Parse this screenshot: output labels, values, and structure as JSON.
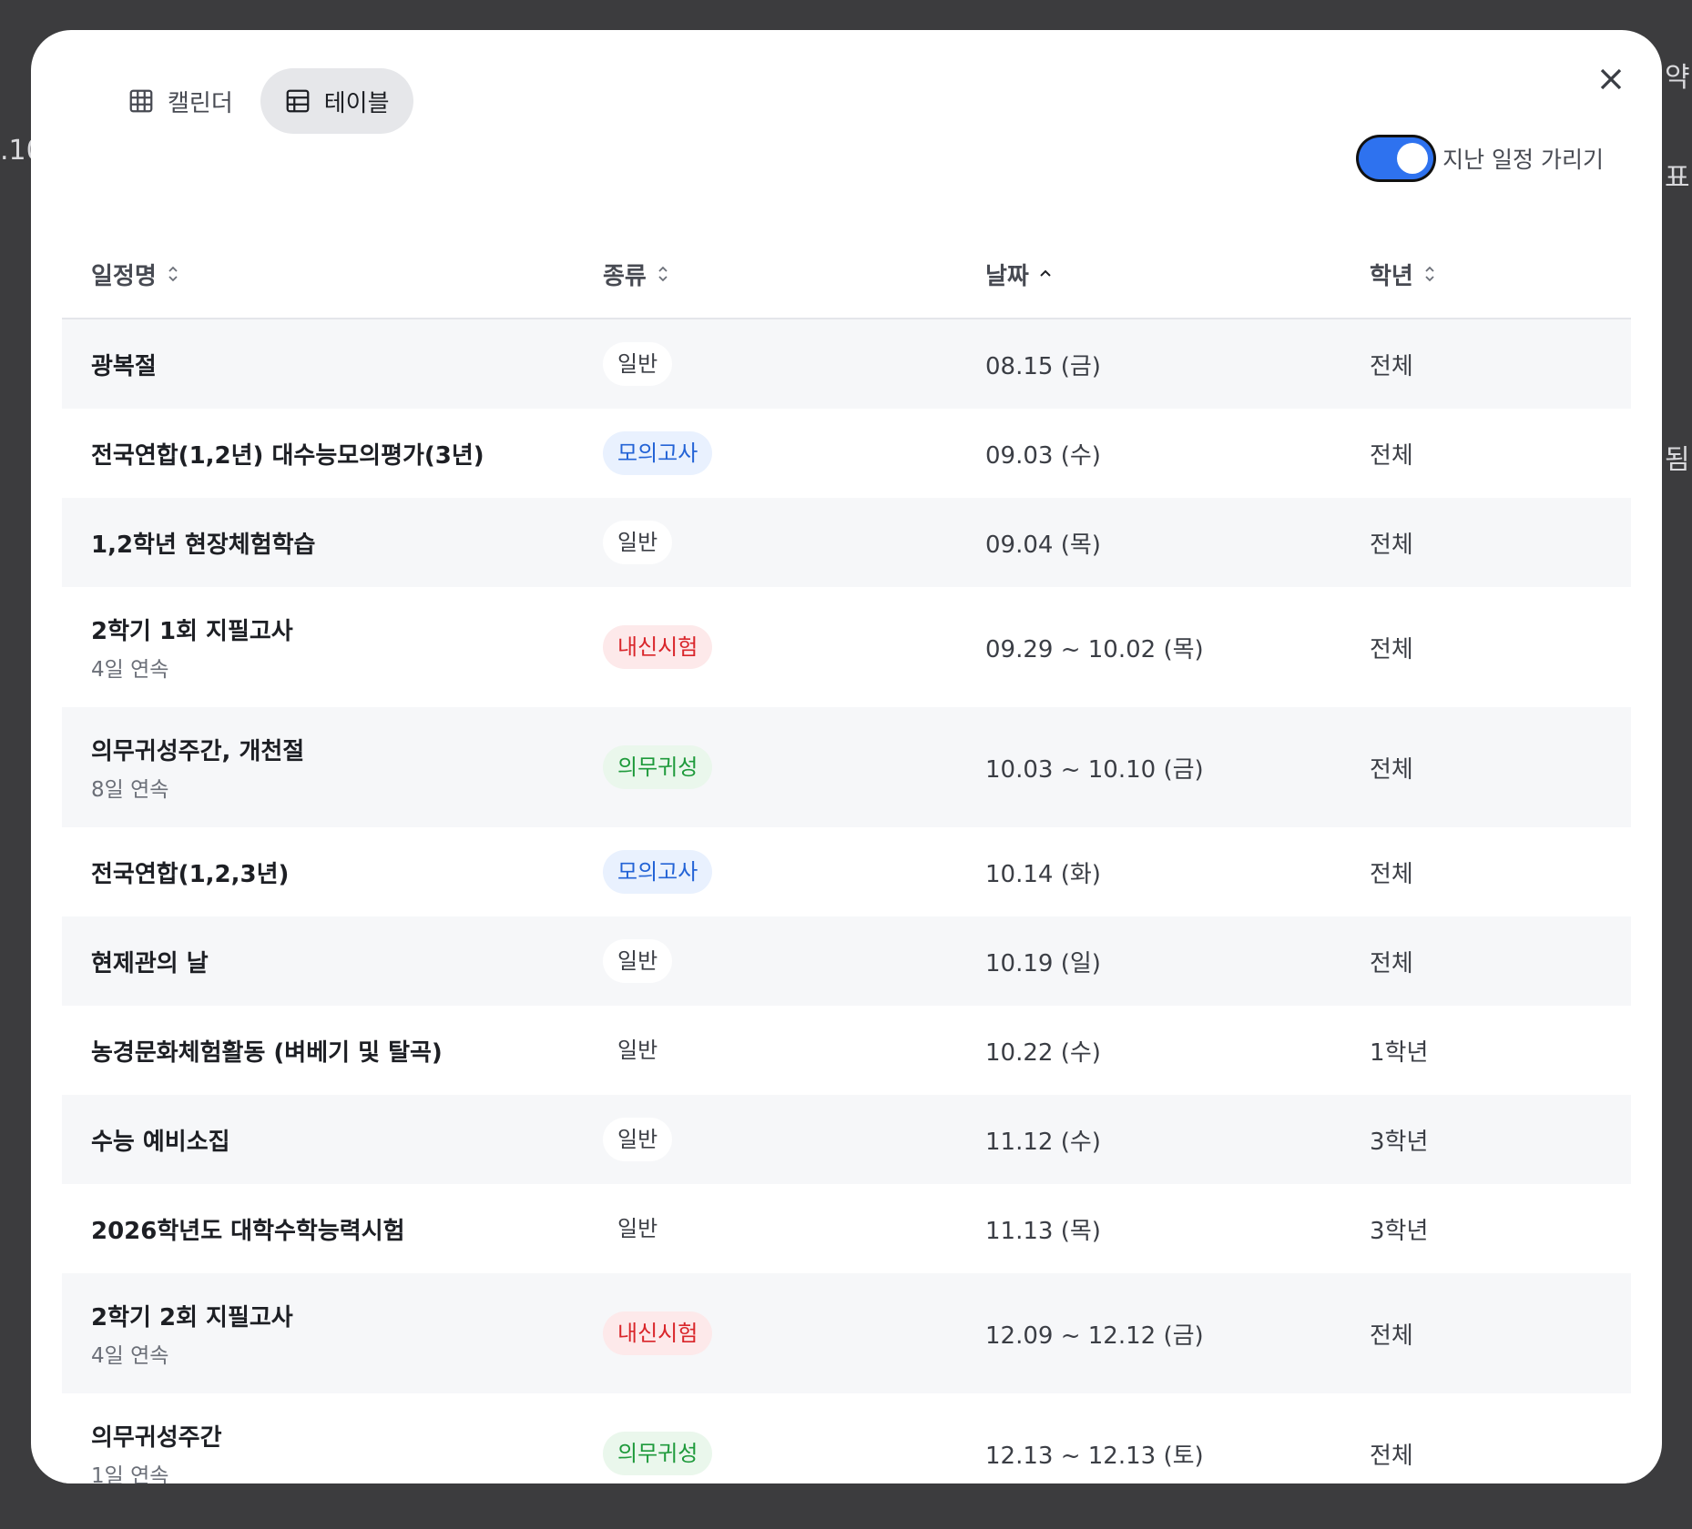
{
  "view_toggle": {
    "calendar_label": "캘린더",
    "table_label": "테이블",
    "active": "table"
  },
  "hide_past": {
    "label": "지난 일정 가리기",
    "enabled": true
  },
  "columns": {
    "name": "일정명",
    "type": "종류",
    "date": "날짜",
    "grade": "학년"
  },
  "sort": {
    "column": "date",
    "direction": "asc"
  },
  "rows": [
    {
      "name": "광복절",
      "sub": "",
      "type": "일반",
      "type_kind": "general",
      "date": "08.15 (금)",
      "grade": "전체"
    },
    {
      "name": "전국연합(1,2년) 대수능모의평가(3년)",
      "sub": "",
      "type": "모의고사",
      "type_kind": "mock",
      "date": "09.03 (수)",
      "grade": "전체"
    },
    {
      "name": "1,2학년 현장체험학습",
      "sub": "",
      "type": "일반",
      "type_kind": "general",
      "date": "09.04 (목)",
      "grade": "전체"
    },
    {
      "name": "2학기 1회 지필고사",
      "sub": "4일 연속",
      "type": "내신시험",
      "type_kind": "exam",
      "date": "09.29 ~ 10.02 (목)",
      "grade": "전체"
    },
    {
      "name": "의무귀성주간, 개천절",
      "sub": "8일 연속",
      "type": "의무귀성",
      "type_kind": "duty",
      "date": "10.03 ~ 10.10 (금)",
      "grade": "전체"
    },
    {
      "name": "전국연합(1,2,3년)",
      "sub": "",
      "type": "모의고사",
      "type_kind": "mock",
      "date": "10.14 (화)",
      "grade": "전체"
    },
    {
      "name": "현제관의 날",
      "sub": "",
      "type": "일반",
      "type_kind": "general",
      "date": "10.19 (일)",
      "grade": "전체"
    },
    {
      "name": "농경문화체험활동 (벼베기 및 탈곡)",
      "sub": "",
      "type": "일반",
      "type_kind": "general",
      "date": "10.22 (수)",
      "grade": "1학년"
    },
    {
      "name": "수능 예비소집",
      "sub": "",
      "type": "일반",
      "type_kind": "general",
      "date": "11.12 (수)",
      "grade": "3학년"
    },
    {
      "name": "2026학년도 대학수학능력시험",
      "sub": "",
      "type": "일반",
      "type_kind": "general",
      "date": "11.13 (목)",
      "grade": "3학년"
    },
    {
      "name": "2학기 2회 지필고사",
      "sub": "4일 연속",
      "type": "내신시험",
      "type_kind": "exam",
      "date": "12.09 ~ 12.12 (금)",
      "grade": "전체"
    },
    {
      "name": "의무귀성주간",
      "sub": "1일 연속",
      "type": "의무귀성",
      "type_kind": "duty",
      "date": "12.13 ~ 12.13 (토)",
      "grade": "전체"
    }
  ],
  "colors": {
    "accent": "#2e72ef",
    "mock": "#2363d6",
    "exam": "#d9252a",
    "duty": "#1e9a3b"
  }
}
